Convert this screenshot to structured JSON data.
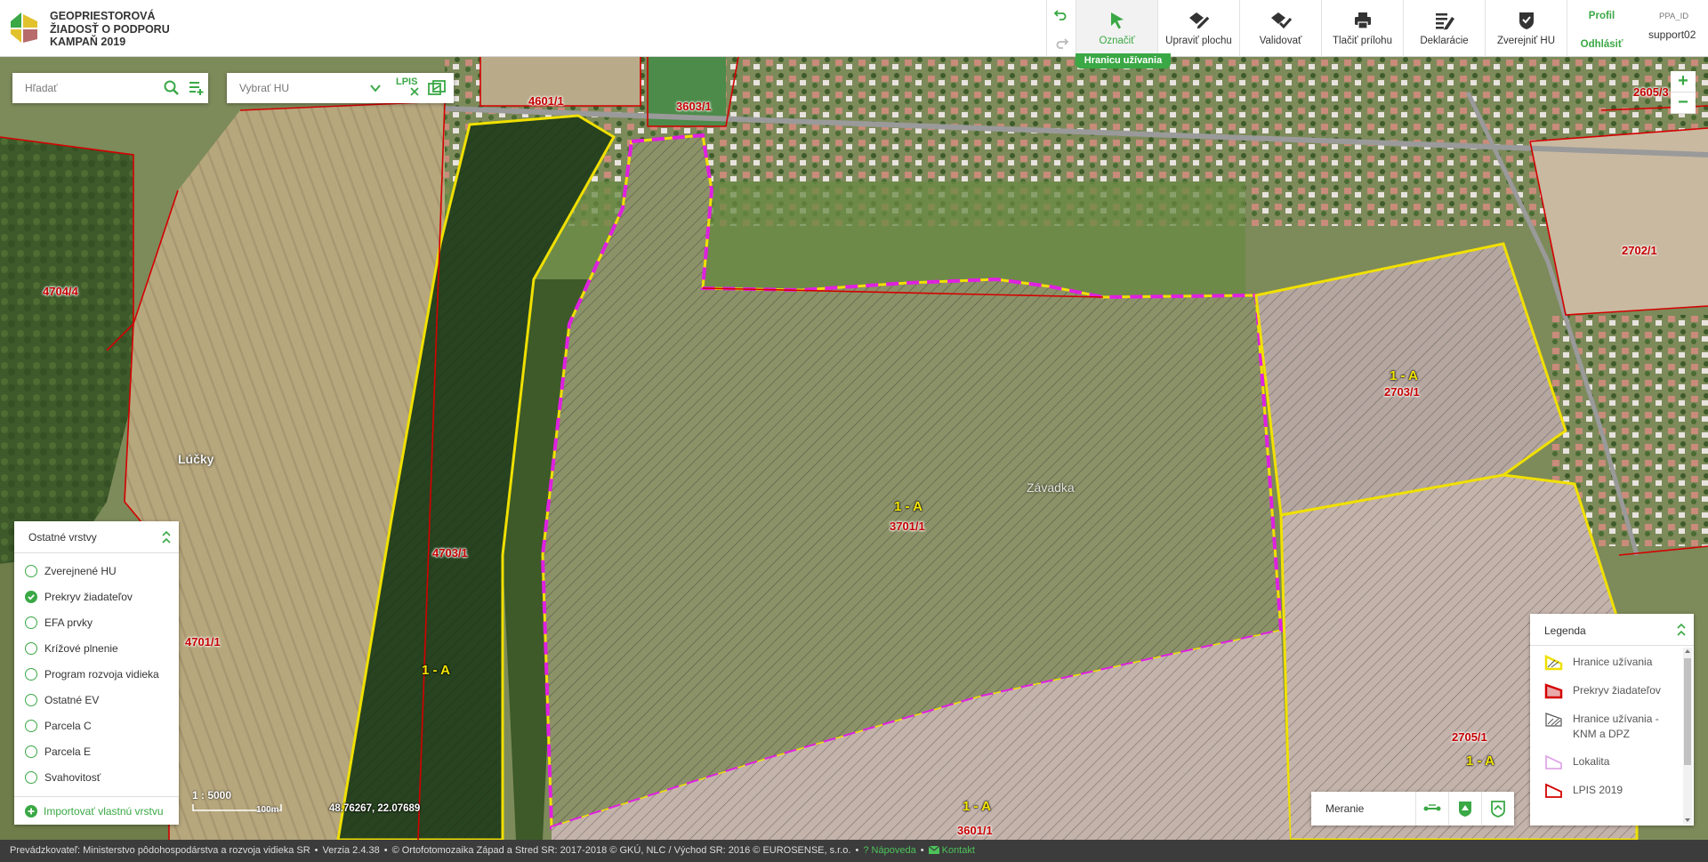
{
  "header": {
    "title_line1": "GEOPRIESTOROVÁ",
    "title_line2": "ŽIADOSŤ O PODPORU",
    "title_line3": "KAMPAŇ 2019",
    "tools": [
      {
        "label": "Označiť",
        "icon": "cursor-icon"
      },
      {
        "label": "Upraviť plochu",
        "icon": "edit-area-icon"
      },
      {
        "label": "Validovať",
        "icon": "validate-icon"
      },
      {
        "label": "Tlačiť prílohu",
        "icon": "printer-icon"
      },
      {
        "label": "Deklarácie",
        "icon": "declaration-icon"
      },
      {
        "label": "Zverejniť HU",
        "icon": "shield-check-icon"
      }
    ],
    "active_tool_hint": "Hranicu užívania",
    "profile": "Profil",
    "logout": "Odhlásiť",
    "user_id_label": "PPA_ID",
    "user_name": "support02"
  },
  "search": {
    "placeholder": "Hľadať",
    "hu_select_placeholder": "Vybrať HU",
    "lpis_label": "LPIS"
  },
  "layers": {
    "title": "Ostatné vrstvy",
    "items": [
      {
        "label": "Zverejnené HU",
        "checked": false
      },
      {
        "label": "Prekryv žiadateľov",
        "checked": true
      },
      {
        "label": "EFA prvky",
        "checked": false
      },
      {
        "label": "Krížové plnenie",
        "checked": false
      },
      {
        "label": "Program rozvoja vidieka",
        "checked": false
      },
      {
        "label": "Ostatné EV",
        "checked": false
      },
      {
        "label": "Parcela C",
        "checked": false
      },
      {
        "label": "Parcela E",
        "checked": false
      },
      {
        "label": "Svahovitosť",
        "checked": false
      }
    ],
    "import_label": "Importovať vlastnú vrstvu"
  },
  "map": {
    "parcels": [
      "4601/1",
      "3603/1",
      "2605/3",
      "4704/4",
      "2702/1",
      "2703/1",
      "4703/1",
      "3701/1",
      "4701/1",
      "2705/1",
      "3601/1"
    ],
    "hu_labels": [
      "1 - A",
      "1 - A",
      "1 - A",
      "1 - A",
      "1 - A"
    ],
    "places": [
      "Lúčky",
      "Závadka"
    ],
    "scale": "1 : 5000",
    "scale_bar": "100m",
    "coordinates": "48.76267, 22.07689"
  },
  "measure": {
    "label": "Meranie"
  },
  "legend": {
    "title": "Legenda",
    "items": [
      {
        "label": "Hranice užívania"
      },
      {
        "label": "Prekryv žiadateľov"
      },
      {
        "label": "Hranice užívania - KNM a DPZ"
      },
      {
        "label": "Lokalita"
      },
      {
        "label": "LPIS 2019"
      }
    ]
  },
  "footer": {
    "provider": "Prevádzkovateľ: Ministerstvo pôdohospodárstva a rozvoja vidieka SR",
    "version": "Verzia 2.4.38",
    "copyright": "© Ortofotomozaika Západ a Stred SR: 2017-2018 © GKÚ, NLC / Východ SR: 2016 © EUROSENSE, s.r.o.",
    "help": "Nápoveda",
    "contact": "Kontakt"
  },
  "colors": {
    "accent": "#3aa845",
    "parcel_border": "#d40000",
    "hu_border": "#f0e000",
    "selection": "#e020e0"
  }
}
